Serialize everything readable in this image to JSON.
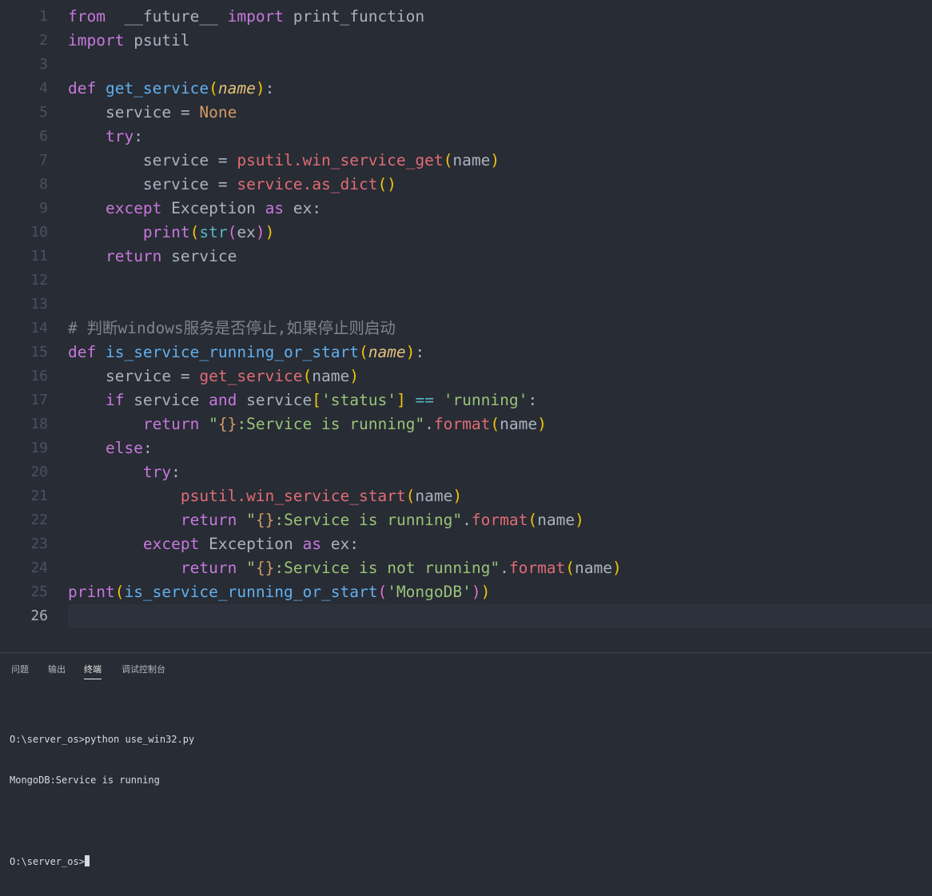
{
  "editor": {
    "lines": [
      {
        "n": "1",
        "tokens": [
          [
            "kw",
            "from"
          ],
          [
            "",
            "  __future__ "
          ],
          [
            "kw",
            "import"
          ],
          [
            "",
            " print_function"
          ]
        ]
      },
      {
        "n": "2",
        "tokens": [
          [
            "kw",
            "import"
          ],
          [
            "",
            " psutil"
          ]
        ]
      },
      {
        "n": "3",
        "tokens": []
      },
      {
        "n": "4",
        "tokens": [
          [
            "kw",
            "def "
          ],
          [
            "fn",
            "get_service"
          ],
          [
            "br",
            "("
          ],
          [
            "pm",
            "name"
          ],
          [
            "br",
            ")"
          ],
          [
            "",
            ":"
          ]
        ]
      },
      {
        "n": "5",
        "tokens": [
          [
            "",
            "    service = "
          ],
          [
            "cn",
            "None"
          ]
        ]
      },
      {
        "n": "6",
        "tokens": [
          [
            "",
            "    "
          ],
          [
            "kw",
            "try"
          ],
          [
            "",
            ":"
          ]
        ]
      },
      {
        "n": "7",
        "tokens": [
          [
            "",
            "        service = "
          ],
          [
            "mt",
            "psutil.win_service_get"
          ],
          [
            "br",
            "("
          ],
          [
            "",
            "name"
          ],
          [
            "br",
            ")"
          ]
        ]
      },
      {
        "n": "8",
        "tokens": [
          [
            "",
            "        service = "
          ],
          [
            "mt",
            "service.as_dict"
          ],
          [
            "br",
            "()"
          ]
        ]
      },
      {
        "n": "9",
        "tokens": [
          [
            "",
            "    "
          ],
          [
            "kw",
            "except"
          ],
          [
            "",
            " Exception "
          ],
          [
            "kw",
            "as"
          ],
          [
            "",
            " ex:"
          ]
        ]
      },
      {
        "n": "10",
        "tokens": [
          [
            "",
            "        "
          ],
          [
            "kw",
            "print"
          ],
          [
            "br",
            "("
          ],
          [
            "bi",
            "str"
          ],
          [
            "br2",
            "("
          ],
          [
            "",
            "ex"
          ],
          [
            "br2",
            ")"
          ],
          [
            "br",
            ")"
          ]
        ]
      },
      {
        "n": "11",
        "tokens": [
          [
            "",
            "    "
          ],
          [
            "kw",
            "return"
          ],
          [
            "",
            " service"
          ]
        ]
      },
      {
        "n": "12",
        "tokens": []
      },
      {
        "n": "13",
        "tokens": []
      },
      {
        "n": "14",
        "tokens": [
          [
            "cm",
            "# 判断windows服务是否停止,如果停止则启动"
          ]
        ]
      },
      {
        "n": "15",
        "tokens": [
          [
            "kw",
            "def "
          ],
          [
            "fn",
            "is_service_running_or_start"
          ],
          [
            "br",
            "("
          ],
          [
            "pm",
            "name"
          ],
          [
            "br",
            ")"
          ],
          [
            "",
            ":"
          ]
        ]
      },
      {
        "n": "16",
        "tokens": [
          [
            "",
            "    service = "
          ],
          [
            "mt",
            "get_service"
          ],
          [
            "br",
            "("
          ],
          [
            "",
            "name"
          ],
          [
            "br",
            ")"
          ]
        ]
      },
      {
        "n": "17",
        "tokens": [
          [
            "",
            "    "
          ],
          [
            "kw",
            "if"
          ],
          [
            "",
            " service "
          ],
          [
            "kw",
            "and"
          ],
          [
            "",
            " service"
          ],
          [
            "br",
            "["
          ],
          [
            "st",
            "'status'"
          ],
          [
            "br",
            "]"
          ],
          [
            "",
            " "
          ],
          [
            "op",
            "=="
          ],
          [
            "",
            " "
          ],
          [
            "st",
            "'running'"
          ],
          [
            "",
            ":"
          ]
        ]
      },
      {
        "n": "18",
        "tokens": [
          [
            "",
            "        "
          ],
          [
            "kw",
            "return"
          ],
          [
            "",
            " "
          ],
          [
            "st",
            "\""
          ],
          [
            "cn",
            "{}"
          ],
          [
            "st",
            ":Service is running\""
          ],
          [
            "",
            ""
          ],
          [
            "",
            "."
          ],
          [
            "mt",
            "format"
          ],
          [
            "br",
            "("
          ],
          [
            "",
            "name"
          ],
          [
            "br",
            ")"
          ]
        ]
      },
      {
        "n": "19",
        "tokens": [
          [
            "",
            "    "
          ],
          [
            "kw",
            "else"
          ],
          [
            "",
            ":"
          ]
        ]
      },
      {
        "n": "20",
        "tokens": [
          [
            "",
            "        "
          ],
          [
            "kw",
            "try"
          ],
          [
            "",
            ":"
          ]
        ]
      },
      {
        "n": "21",
        "tokens": [
          [
            "",
            "            "
          ],
          [
            "mt",
            "psutil.win_service_start"
          ],
          [
            "br",
            "("
          ],
          [
            "",
            "name"
          ],
          [
            "br",
            ")"
          ]
        ]
      },
      {
        "n": "22",
        "tokens": [
          [
            "",
            "            "
          ],
          [
            "kw",
            "return"
          ],
          [
            "",
            " "
          ],
          [
            "st",
            "\""
          ],
          [
            "cn",
            "{}"
          ],
          [
            "st",
            ":Service is running\""
          ],
          [
            "",
            "."
          ],
          [
            "mt",
            "format"
          ],
          [
            "br",
            "("
          ],
          [
            "",
            "name"
          ],
          [
            "br",
            ")"
          ]
        ]
      },
      {
        "n": "23",
        "tokens": [
          [
            "",
            "        "
          ],
          [
            "kw",
            "except"
          ],
          [
            "",
            " Exception "
          ],
          [
            "kw",
            "as"
          ],
          [
            "",
            " ex:"
          ]
        ]
      },
      {
        "n": "24",
        "tokens": [
          [
            "",
            "            "
          ],
          [
            "kw",
            "return"
          ],
          [
            "",
            " "
          ],
          [
            "st",
            "\""
          ],
          [
            "cn",
            "{}"
          ],
          [
            "st",
            ":Service is not running\""
          ],
          [
            "",
            "."
          ],
          [
            "mt",
            "format"
          ],
          [
            "br",
            "("
          ],
          [
            "",
            "name"
          ],
          [
            "br",
            ")"
          ]
        ]
      },
      {
        "n": "25",
        "tokens": [
          [
            "kw",
            "print"
          ],
          [
            "br",
            "("
          ],
          [
            "fn",
            "is_service_running_or_start"
          ],
          [
            "br2",
            "("
          ],
          [
            "st",
            "'MongoDB'"
          ],
          [
            "br2",
            ")"
          ],
          [
            "br",
            ")"
          ]
        ]
      },
      {
        "n": "26",
        "tokens": []
      }
    ],
    "current_line": "26"
  },
  "panel": {
    "tabs": [
      {
        "id": "problems",
        "label": "问题",
        "active": false
      },
      {
        "id": "output",
        "label": "输出",
        "active": false
      },
      {
        "id": "terminal",
        "label": "终端",
        "active": true
      },
      {
        "id": "debug-console",
        "label": "调试控制台",
        "active": false
      }
    ],
    "terminal": {
      "lines": [
        "O:\\server_os>python use_win32.py",
        "MongoDB:Service is running",
        "",
        "O:\\server_os>"
      ]
    }
  },
  "colors": {
    "background": "#282c34",
    "keyword": "#c678dd",
    "function": "#61afef",
    "string": "#98c379",
    "comment": "#7f848e"
  }
}
